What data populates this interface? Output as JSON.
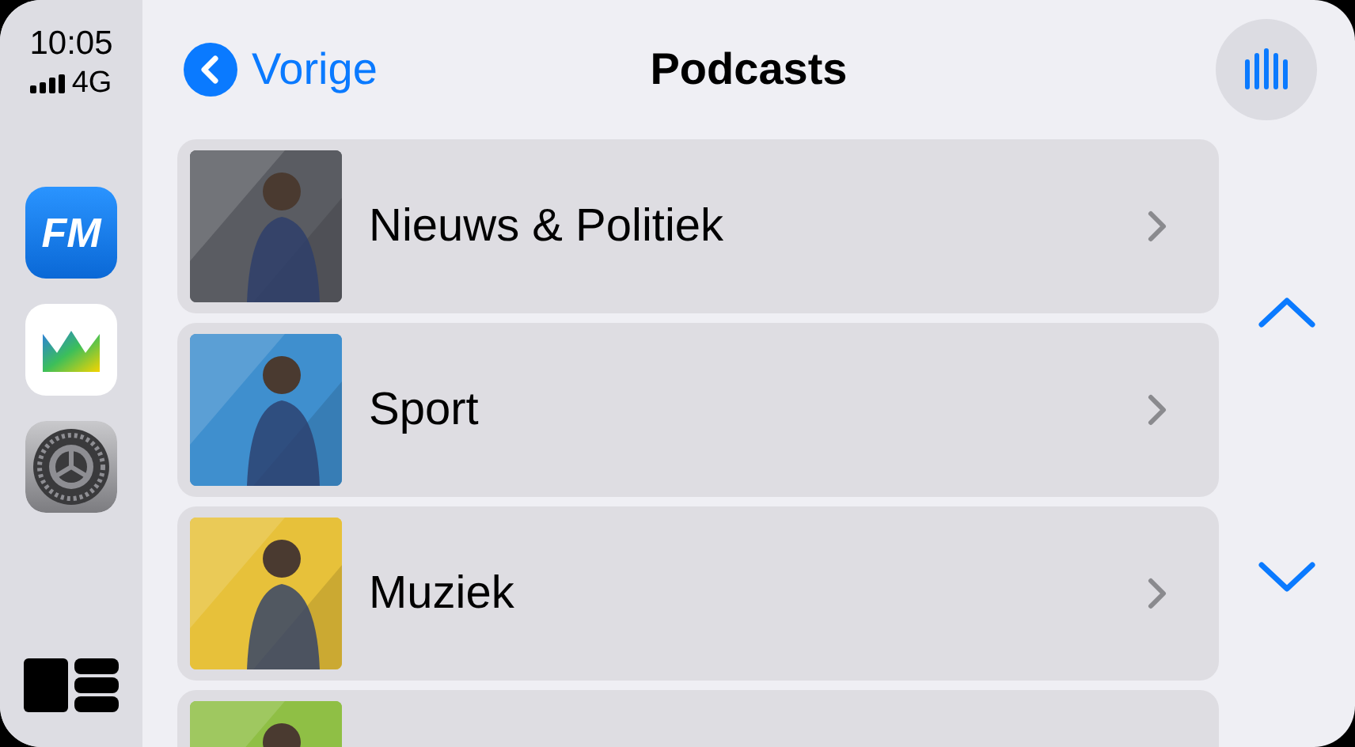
{
  "status": {
    "time": "10:05",
    "network": "4G"
  },
  "apps": [
    {
      "kind": "fm",
      "label": "FM"
    },
    {
      "kind": "crown"
    },
    {
      "kind": "settings"
    }
  ],
  "nav": {
    "back": "Vorige",
    "title": "Podcasts"
  },
  "rows": [
    {
      "title": "Nieuws & Politiek",
      "color": "#5a5c62"
    },
    {
      "title": "Sport",
      "color": "#3f8fce"
    },
    {
      "title": "Muziek",
      "color": "#e7c13a"
    },
    {
      "color": "#8fbf45"
    }
  ]
}
